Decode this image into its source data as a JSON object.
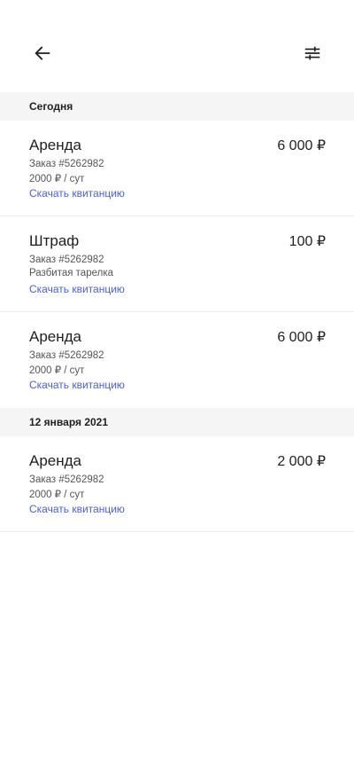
{
  "header": {
    "back_icon": "arrow-left-icon",
    "filter_icon": "filter-sliders-icon"
  },
  "sections": [
    {
      "title": "Сегодня",
      "items": [
        {
          "title": "Аренда",
          "amount": "6 000 ₽",
          "order": "Заказ #5262982",
          "detail": "2000 ₽ / сут",
          "link": "Скачать квитанцию"
        },
        {
          "title": "Штраф",
          "amount": "100 ₽",
          "order": "Заказ #5262982",
          "detail": "Разбитая тарелка",
          "link": "Скачать квитанцию"
        },
        {
          "title": "Аренда",
          "amount": "6 000 ₽",
          "order": "Заказ #5262982",
          "detail": "2000 ₽ / сут",
          "link": "Скачать квитанцию"
        }
      ]
    },
    {
      "title": "12 января 2021",
      "items": [
        {
          "title": "Аренда",
          "amount": "2 000 ₽",
          "order": "Заказ #5262982",
          "detail": "2000 ₽ / сут",
          "link": "Скачать квитанцию"
        }
      ]
    }
  ]
}
